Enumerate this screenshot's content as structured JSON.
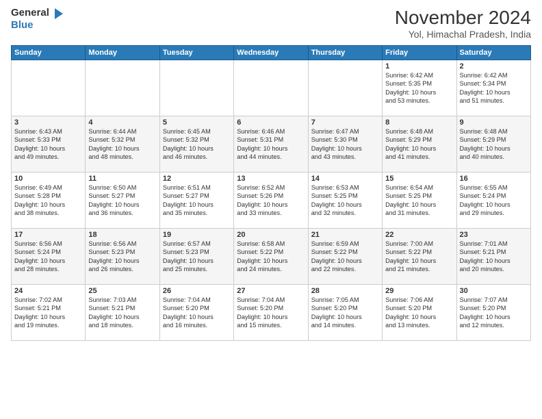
{
  "header": {
    "logo_line1": "General",
    "logo_line2": "Blue",
    "month": "November 2024",
    "location": "Yol, Himachal Pradesh, India"
  },
  "weekdays": [
    "Sunday",
    "Monday",
    "Tuesday",
    "Wednesday",
    "Thursday",
    "Friday",
    "Saturday"
  ],
  "weeks": [
    [
      {
        "day": "",
        "info": ""
      },
      {
        "day": "",
        "info": ""
      },
      {
        "day": "",
        "info": ""
      },
      {
        "day": "",
        "info": ""
      },
      {
        "day": "",
        "info": ""
      },
      {
        "day": "1",
        "info": "Sunrise: 6:42 AM\nSunset: 5:35 PM\nDaylight: 10 hours\nand 53 minutes."
      },
      {
        "day": "2",
        "info": "Sunrise: 6:42 AM\nSunset: 5:34 PM\nDaylight: 10 hours\nand 51 minutes."
      }
    ],
    [
      {
        "day": "3",
        "info": "Sunrise: 6:43 AM\nSunset: 5:33 PM\nDaylight: 10 hours\nand 49 minutes."
      },
      {
        "day": "4",
        "info": "Sunrise: 6:44 AM\nSunset: 5:32 PM\nDaylight: 10 hours\nand 48 minutes."
      },
      {
        "day": "5",
        "info": "Sunrise: 6:45 AM\nSunset: 5:32 PM\nDaylight: 10 hours\nand 46 minutes."
      },
      {
        "day": "6",
        "info": "Sunrise: 6:46 AM\nSunset: 5:31 PM\nDaylight: 10 hours\nand 44 minutes."
      },
      {
        "day": "7",
        "info": "Sunrise: 6:47 AM\nSunset: 5:30 PM\nDaylight: 10 hours\nand 43 minutes."
      },
      {
        "day": "8",
        "info": "Sunrise: 6:48 AM\nSunset: 5:29 PM\nDaylight: 10 hours\nand 41 minutes."
      },
      {
        "day": "9",
        "info": "Sunrise: 6:48 AM\nSunset: 5:29 PM\nDaylight: 10 hours\nand 40 minutes."
      }
    ],
    [
      {
        "day": "10",
        "info": "Sunrise: 6:49 AM\nSunset: 5:28 PM\nDaylight: 10 hours\nand 38 minutes."
      },
      {
        "day": "11",
        "info": "Sunrise: 6:50 AM\nSunset: 5:27 PM\nDaylight: 10 hours\nand 36 minutes."
      },
      {
        "day": "12",
        "info": "Sunrise: 6:51 AM\nSunset: 5:27 PM\nDaylight: 10 hours\nand 35 minutes."
      },
      {
        "day": "13",
        "info": "Sunrise: 6:52 AM\nSunset: 5:26 PM\nDaylight: 10 hours\nand 33 minutes."
      },
      {
        "day": "14",
        "info": "Sunrise: 6:53 AM\nSunset: 5:25 PM\nDaylight: 10 hours\nand 32 minutes."
      },
      {
        "day": "15",
        "info": "Sunrise: 6:54 AM\nSunset: 5:25 PM\nDaylight: 10 hours\nand 31 minutes."
      },
      {
        "day": "16",
        "info": "Sunrise: 6:55 AM\nSunset: 5:24 PM\nDaylight: 10 hours\nand 29 minutes."
      }
    ],
    [
      {
        "day": "17",
        "info": "Sunrise: 6:56 AM\nSunset: 5:24 PM\nDaylight: 10 hours\nand 28 minutes."
      },
      {
        "day": "18",
        "info": "Sunrise: 6:56 AM\nSunset: 5:23 PM\nDaylight: 10 hours\nand 26 minutes."
      },
      {
        "day": "19",
        "info": "Sunrise: 6:57 AM\nSunset: 5:23 PM\nDaylight: 10 hours\nand 25 minutes."
      },
      {
        "day": "20",
        "info": "Sunrise: 6:58 AM\nSunset: 5:22 PM\nDaylight: 10 hours\nand 24 minutes."
      },
      {
        "day": "21",
        "info": "Sunrise: 6:59 AM\nSunset: 5:22 PM\nDaylight: 10 hours\nand 22 minutes."
      },
      {
        "day": "22",
        "info": "Sunrise: 7:00 AM\nSunset: 5:22 PM\nDaylight: 10 hours\nand 21 minutes."
      },
      {
        "day": "23",
        "info": "Sunrise: 7:01 AM\nSunset: 5:21 PM\nDaylight: 10 hours\nand 20 minutes."
      }
    ],
    [
      {
        "day": "24",
        "info": "Sunrise: 7:02 AM\nSunset: 5:21 PM\nDaylight: 10 hours\nand 19 minutes."
      },
      {
        "day": "25",
        "info": "Sunrise: 7:03 AM\nSunset: 5:21 PM\nDaylight: 10 hours\nand 18 minutes."
      },
      {
        "day": "26",
        "info": "Sunrise: 7:04 AM\nSunset: 5:20 PM\nDaylight: 10 hours\nand 16 minutes."
      },
      {
        "day": "27",
        "info": "Sunrise: 7:04 AM\nSunset: 5:20 PM\nDaylight: 10 hours\nand 15 minutes."
      },
      {
        "day": "28",
        "info": "Sunrise: 7:05 AM\nSunset: 5:20 PM\nDaylight: 10 hours\nand 14 minutes."
      },
      {
        "day": "29",
        "info": "Sunrise: 7:06 AM\nSunset: 5:20 PM\nDaylight: 10 hours\nand 13 minutes."
      },
      {
        "day": "30",
        "info": "Sunrise: 7:07 AM\nSunset: 5:20 PM\nDaylight: 10 hours\nand 12 minutes."
      }
    ]
  ]
}
